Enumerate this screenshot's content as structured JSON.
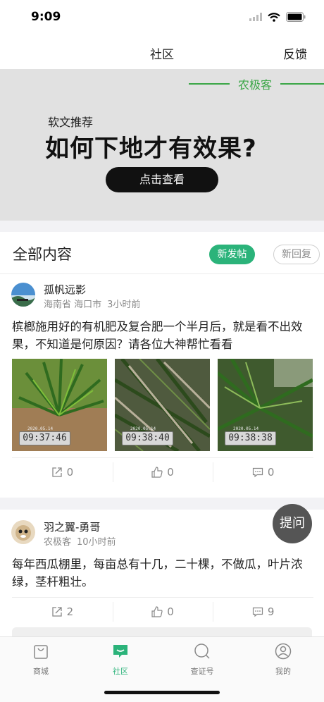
{
  "status": {
    "time": "9:09"
  },
  "nav": {
    "title": "社区",
    "right": "反馈"
  },
  "banner": {
    "brand": "农极客",
    "subtitle": "软文推荐",
    "title": "如何下地才有效果?",
    "button": "点击查看"
  },
  "section": {
    "title": "全部内容",
    "new_post": "新发帖",
    "new_reply": "新回复"
  },
  "posts": [
    {
      "user": "孤帆远影",
      "location": "海南省 海口市",
      "time": "3小时前",
      "text": "槟榔施用好的有机肥及复合肥一个半月后，就是看不出效果，不知道是何原因？请各位大神帮忙看看",
      "photos": [
        {
          "stamp": "09:37:46",
          "date": "2020.05.14"
        },
        {
          "stamp": "09:38:40",
          "date": "2020.05.14"
        },
        {
          "stamp": "09:38:38",
          "date": "2020.05.14"
        }
      ],
      "share": "0",
      "likes": "0",
      "comments": "0"
    },
    {
      "user": "羽之翼-勇哥",
      "location": "农极客",
      "time": "10小时前",
      "text": "每年西瓜棚里，每亩总有十几，二十棵，不做瓜，叶片浓绿，茎杆粗壮。",
      "share": "2",
      "likes": "0",
      "comments": "9"
    }
  ],
  "ask_button": "提问",
  "tabs": [
    {
      "label": "商城",
      "icon": "bag-icon"
    },
    {
      "label": "社区",
      "icon": "chat-icon",
      "active": true
    },
    {
      "label": "查证号",
      "icon": "search-icon"
    },
    {
      "label": "我的",
      "icon": "user-icon"
    }
  ],
  "colors": {
    "accent": "#2bb37a",
    "brand_green": "#3aa646",
    "banner_bg": "#e1e1e1"
  }
}
